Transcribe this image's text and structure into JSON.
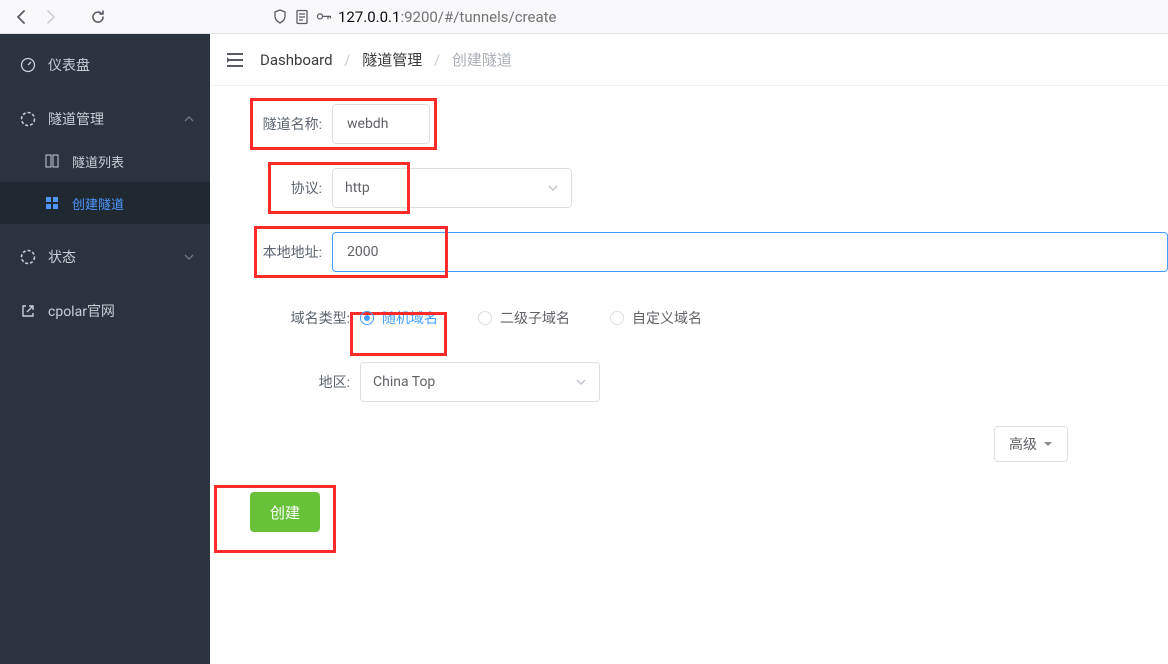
{
  "browser": {
    "url_prefix": "127.0.0.1",
    "url_suffix": ":9200/#/tunnels/create"
  },
  "sidebar": {
    "dashboard": "仪表盘",
    "tunnel_mgmt": "隧道管理",
    "tunnel_list": "隧道列表",
    "create_tunnel": "创建隧道",
    "status": "状态",
    "cpolar": "cpolar官网"
  },
  "breadcrumb": {
    "a": "Dashboard",
    "b": "隧道管理",
    "c": "创建隧道"
  },
  "form": {
    "name_label": "隧道名称:",
    "name_value": "webdh",
    "proto_label": "协议:",
    "proto_value": "http",
    "local_label": "本地地址:",
    "local_value": "2000",
    "domain_type_label": "域名类型:",
    "domain_random": "随机域名",
    "domain_second": "二级子域名",
    "domain_custom": "自定义域名",
    "region_label": "地区:",
    "region_value": "China Top",
    "advanced": "高级",
    "create": "创建"
  }
}
